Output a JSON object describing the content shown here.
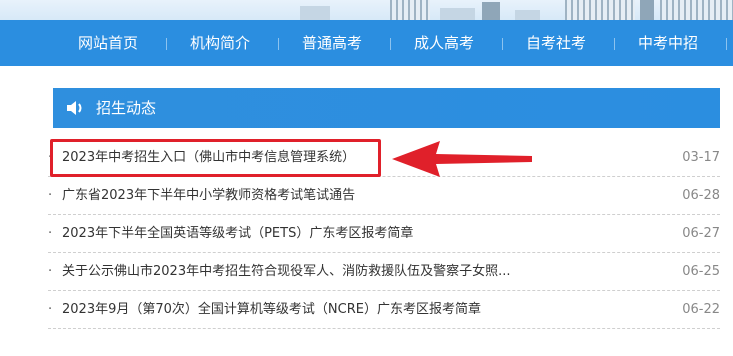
{
  "nav": {
    "items": [
      {
        "label": "网站首页"
      },
      {
        "label": "机构简介"
      },
      {
        "label": "普通高考"
      },
      {
        "label": "成人高考"
      },
      {
        "label": "自考社考"
      },
      {
        "label": "中考中招"
      }
    ]
  },
  "section": {
    "icon": "speaker-icon",
    "title": "招生动态"
  },
  "news": [
    {
      "title": "2023年中考招生入口（佛山市中考信息管理系统）",
      "date": "03-17"
    },
    {
      "title": "广东省2023年下半年中小学教师资格考试笔试通告",
      "date": "06-28"
    },
    {
      "title": "2023年下半年全国英语等级考试（PETS）广东考区报考简章",
      "date": "06-27"
    },
    {
      "title": "关于公示佛山市2023年中考招生符合现役军人、消防救援队伍及警察子女照...",
      "date": "06-25"
    },
    {
      "title": "2023年9月（第70次）全国计算机等级考试（NCRE）广东考区报考简章",
      "date": "06-22"
    }
  ],
  "annotation": {
    "box_color": "#e0202a",
    "arrow_color": "#e0202a"
  },
  "colors": {
    "nav_bg": "#2b8ee0",
    "section_bg": "#2b8ee0"
  }
}
